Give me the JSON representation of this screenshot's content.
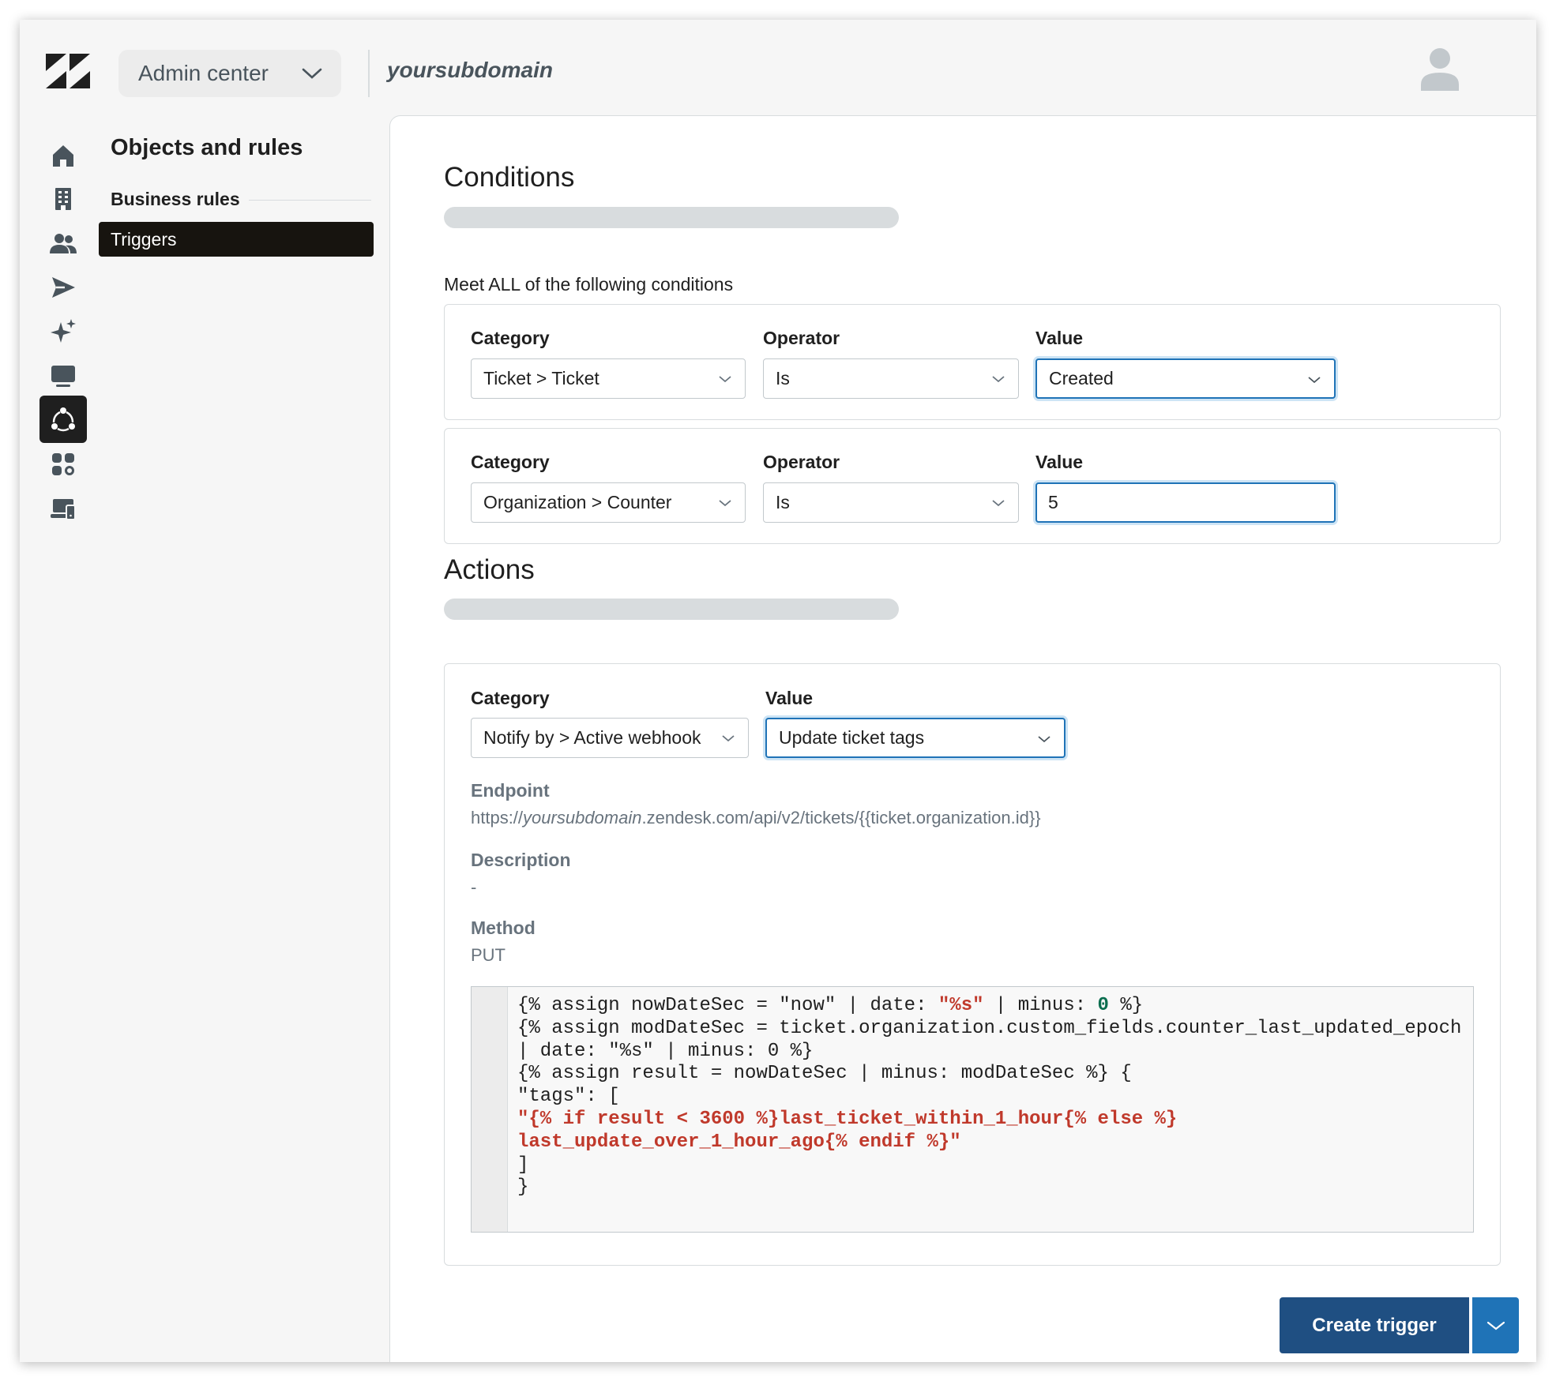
{
  "header": {
    "product_switcher_label": "Admin center",
    "subdomain": "yoursubdomain"
  },
  "rail": {
    "items": [
      "home-icon",
      "building-icon",
      "people-icon",
      "send-icon",
      "sparkle-icon",
      "monitor-icon",
      "objects-rules-icon",
      "apps-icon",
      "devices-icon"
    ],
    "active": "objects-rules-icon"
  },
  "nav": {
    "title": "Objects and rules",
    "section": "Business rules",
    "active_item": "Triggers"
  },
  "conditions": {
    "heading": "Conditions",
    "meet_text": "Meet ALL of the following conditions",
    "rows": [
      {
        "category_label": "Category",
        "category": "Ticket > Ticket",
        "operator_label": "Operator",
        "operator": "Is",
        "value_label": "Value",
        "value": "Created"
      },
      {
        "category_label": "Category",
        "category": "Organization > Counter",
        "operator_label": "Operator",
        "operator": "Is",
        "value_label": "Value",
        "value": "5"
      }
    ]
  },
  "actions": {
    "heading": "Actions",
    "category_label": "Category",
    "category": "Notify by > Active webhook",
    "value_label": "Value",
    "value": "Update ticket tags",
    "endpoint_label": "Endpoint",
    "endpoint_prefix": "https://",
    "endpoint_subdomain": "yoursubdomain",
    "endpoint_suffix": ".zendesk.com/api/v2/tickets/{{ticket.organization.id}}",
    "description_label": "Description",
    "description": "-",
    "method_label": "Method",
    "method": "PUT",
    "code": {
      "l1a": "{% assign nowDateSec = \"now\" | date: ",
      "l1s": "\"%s\"",
      "l1b": " | minus: ",
      "l1n": "0",
      "l1c": " %}",
      "l2": "{% assign modDateSec = ticket.organization.custom_fields.counter_last_updated_epoch | date: \"%s\" | minus: 0 %}",
      "l3": "{% assign result = nowDateSec | minus: modDateSec %} {",
      "l4": "\"tags\": [",
      "l5": "\"{% if result < 3600 %}last_ticket_within_1_hour{% else %} last_update_over_1_hour_ago{% endif %}\"",
      "l6": "]",
      "l7": "}"
    }
  },
  "footer": {
    "create_label": "Create trigger"
  },
  "colors": {
    "primary": "#1f4f82",
    "primary_accent": "#1f73b7",
    "active_nav": "#17140f"
  }
}
